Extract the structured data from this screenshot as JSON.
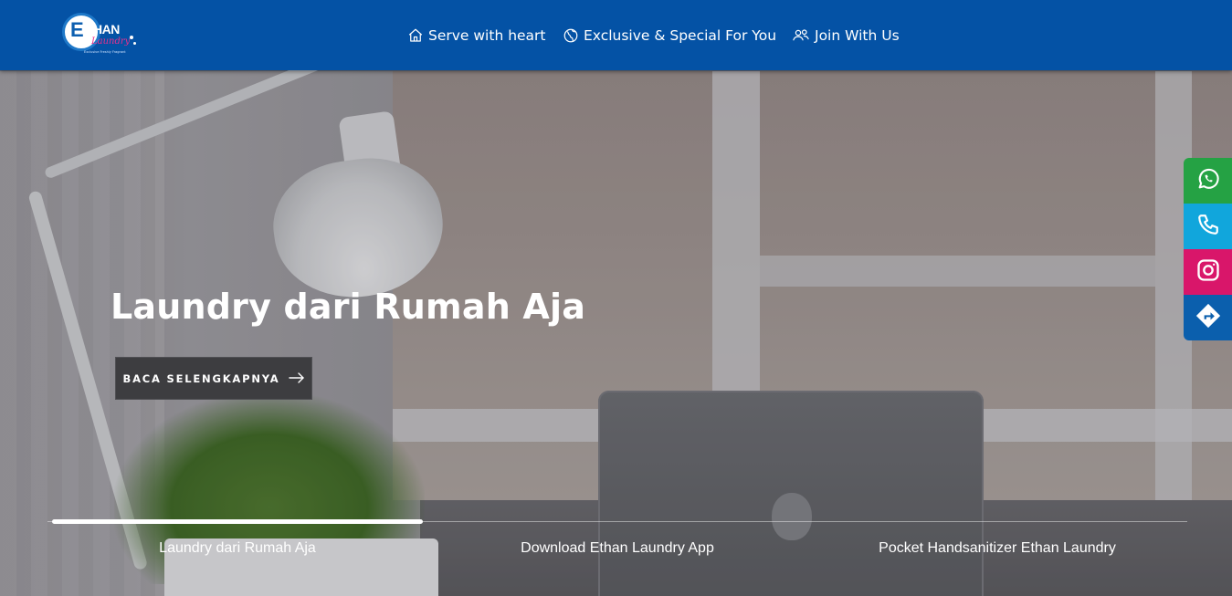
{
  "brand": {
    "logo_name": "Ethan Laundry logo",
    "logo_e": "E",
    "logo_than": "THAN",
    "logo_laundry": "Laundry",
    "logo_tagline": "Exclusive Freshly Fragrant"
  },
  "nav": {
    "items": [
      {
        "label": "Serve with heart",
        "icon": "home-icon"
      },
      {
        "label": "Exclusive & Special For You",
        "icon": "globe-icon"
      },
      {
        "label": "Join With Us",
        "icon": "users-icon"
      }
    ]
  },
  "hero": {
    "title": "Laundry dari Rumah Aja",
    "button_label": "BACA SELENGKAPNYA",
    "button_icon": "arrow-right-icon"
  },
  "slider": {
    "active_index": 0,
    "progress": 1.0,
    "tabs": [
      {
        "label": "Laundry dari Rumah Aja"
      },
      {
        "label": "Download Ethan Laundry App"
      },
      {
        "label": "Pocket Handsanitizer Ethan Laundry"
      }
    ]
  },
  "floating_contacts": [
    {
      "name": "whatsapp",
      "icon": "whatsapp-icon",
      "color": "#25a244"
    },
    {
      "name": "phone",
      "icon": "phone-icon",
      "color": "#11a6dc"
    },
    {
      "name": "instagram",
      "icon": "instagram-icon",
      "color": "#d9166a"
    },
    {
      "name": "directions",
      "icon": "directions-icon",
      "color": "#0b5fad"
    }
  ],
  "colors": {
    "header_bg": "#0452a5",
    "button_bg": "#3d3d40"
  }
}
